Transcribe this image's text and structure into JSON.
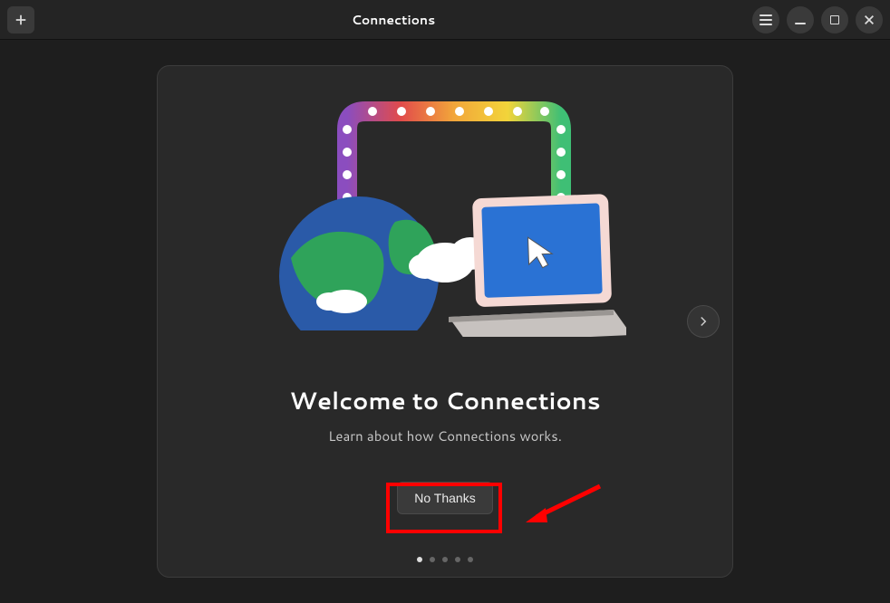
{
  "header": {
    "title": "Connections",
    "add_label": "Add",
    "menu_label": "Menu",
    "minimize_label": "Minimize",
    "maximize_label": "Maximize",
    "close_label": "Close"
  },
  "welcome": {
    "title": "Welcome to Connections",
    "subtitle": "Learn about how Connections works.",
    "no_thanks_label": "No Thanks"
  },
  "paginator": {
    "total": 5,
    "active_index": 0
  },
  "nav": {
    "next_label": "Next"
  },
  "annotation": {
    "highlight_target": "no-thanks-button",
    "arrow_points_to": "no-thanks-button"
  }
}
